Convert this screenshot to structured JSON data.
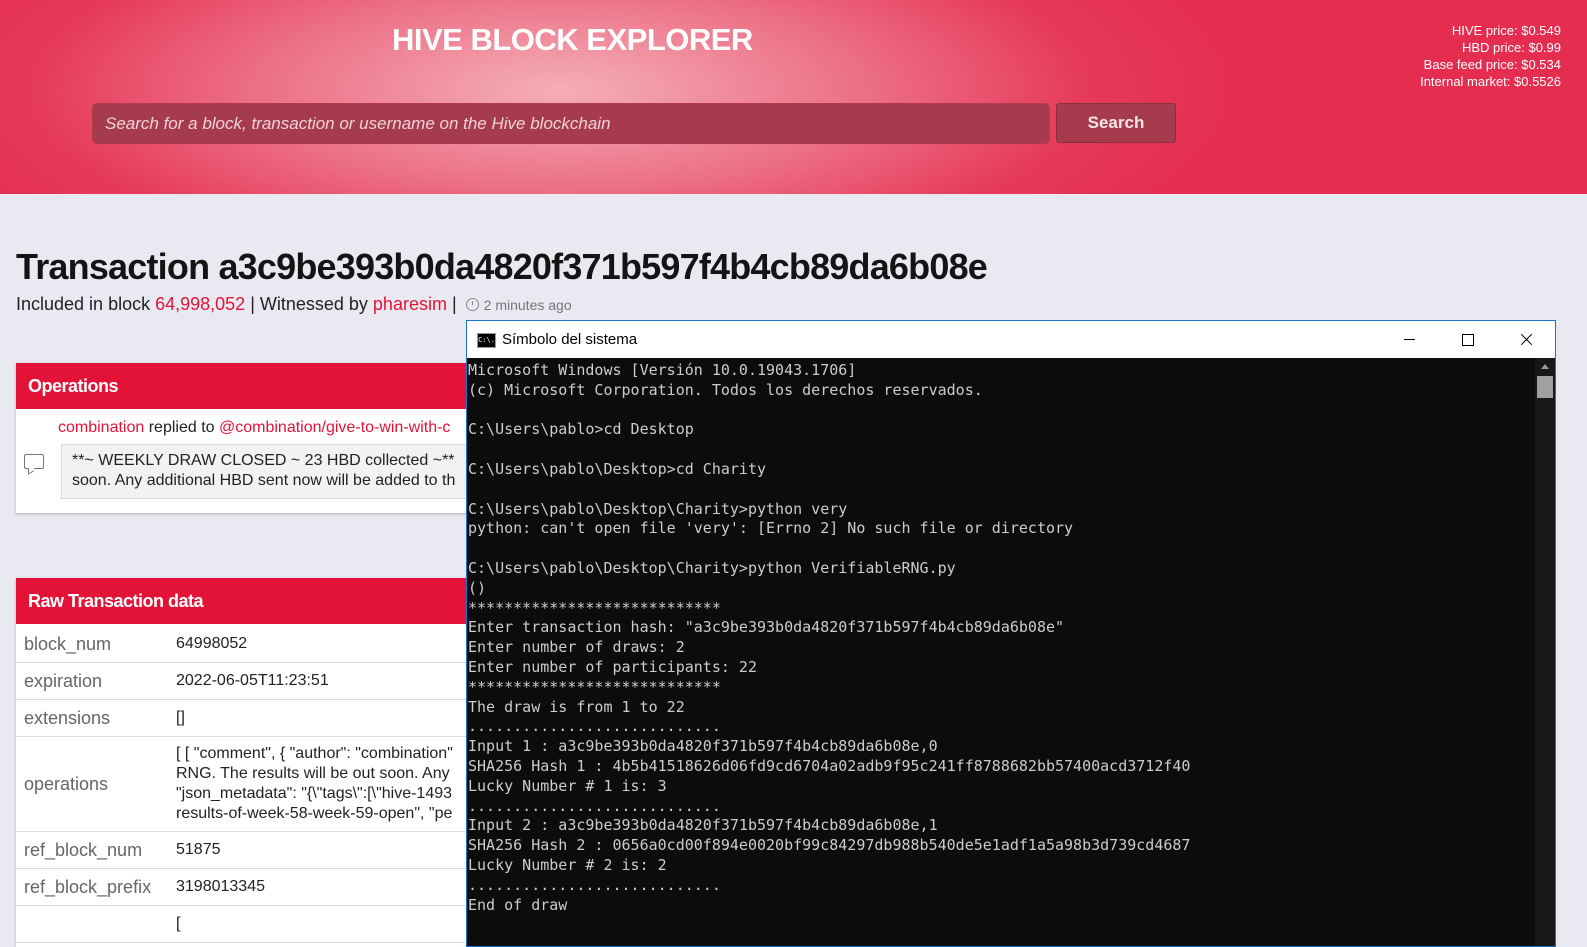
{
  "header": {
    "title": "HIVE BLOCK EXPLORER",
    "prices": [
      "HIVE price: $0.549",
      "HBD price: $0.99",
      "Base feed price: $0.534",
      "Internal market: $0.5526"
    ],
    "search_placeholder": "Search for a block, transaction or username on the Hive blockchain",
    "search_button": "Search"
  },
  "transaction": {
    "title": "Transaction a3c9be393b0da4820f371b597f4b4cb89da6b08e",
    "included_label": "Included in block ",
    "block": "64,998,052",
    "witnessed_label": " | Witnessed by ",
    "witness": "pharesim",
    "sep": " | ",
    "time_ago": "2 minutes ago"
  },
  "operations": {
    "header": "Operations",
    "author": "combination",
    "action": " replied to ",
    "target": "@combination/give-to-win-with-c",
    "body_line1": "**~ WEEKLY DRAW CLOSED ~ 23 HBD collected ~**",
    "body_line2": "soon. Any additional HBD sent now will be added to th"
  },
  "raw": {
    "header": "Raw Transaction data",
    "rows": [
      {
        "key": "block_num",
        "value": "64998052"
      },
      {
        "key": "expiration",
        "value": "2022-06-05T11:23:51"
      },
      {
        "key": "extensions",
        "value": "[]"
      },
      {
        "key": "operations",
        "lines": [
          "[ [ \"comment\", { \"author\": \"combination\"",
          "RNG. The results will be out soon. Any",
          "\"json_metadata\": \"{\\\"tags\\\":[\\\"hive-1493",
          "results-of-week-58-week-59-open\", \"pe"
        ]
      },
      {
        "key": "ref_block_num",
        "value": "51875"
      },
      {
        "key": "ref_block_prefix",
        "value": "3198013345"
      },
      {
        "key": "",
        "value": "["
      }
    ]
  },
  "cmd": {
    "title": "Símbolo del sistema",
    "icon_text": "C:\\.",
    "lines": [
      "Microsoft Windows [Versión 10.0.19043.1706]",
      "(c) Microsoft Corporation. Todos los derechos reservados.",
      "",
      "C:\\Users\\pablo>cd Desktop",
      "",
      "C:\\Users\\pablo\\Desktop>cd Charity",
      "",
      "C:\\Users\\pablo\\Desktop\\Charity>python very",
      "python: can't open file 'very': [Errno 2] No such file or directory",
      "",
      "C:\\Users\\pablo\\Desktop\\Charity>python VerifiableRNG.py",
      "()",
      "****************************",
      "Enter transaction hash: \"a3c9be393b0da4820f371b597f4b4cb89da6b08e\"",
      "Enter number of draws: 2",
      "Enter number of participants: 22",
      "****************************",
      "The draw is from 1 to 22",
      "............................",
      "Input 1 : a3c9be393b0da4820f371b597f4b4cb89da6b08e,0",
      "SHA256 Hash 1 : 4b5b41518626d06fd9cd6704a02adb9f95c241ff8788682bb57400acd3712f40",
      "Lucky Number # 1 is: 3",
      "............................",
      "Input 2 : a3c9be393b0da4820f371b597f4b4cb89da6b08e,1",
      "SHA256 Hash 2 : 0656a0cd00f894e0020bf99c84297db988b540de5e1adf1a5a98b3d739cd4687",
      "Lucky Number # 2 is: 2",
      "............................",
      "End of draw"
    ]
  }
}
